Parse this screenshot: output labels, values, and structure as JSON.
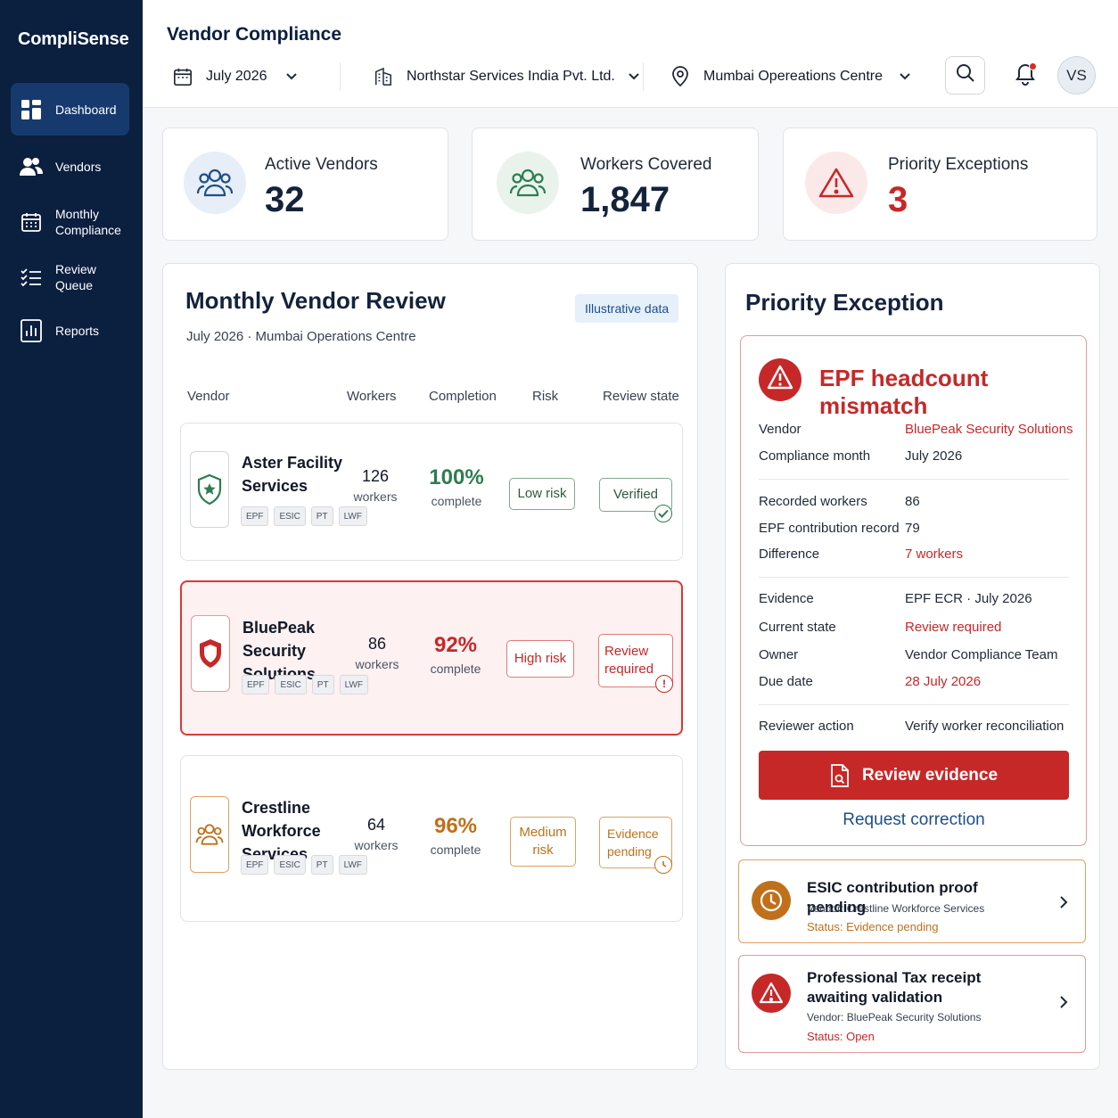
{
  "app": {
    "brand": "CompliSense"
  },
  "sidebar": {
    "items": [
      {
        "label": "Dashboard",
        "icon": "dashboard-icon",
        "active": true
      },
      {
        "label": "Vendors",
        "icon": "users-icon"
      },
      {
        "label": "Monthly Compliance",
        "icon": "calendar-icon"
      },
      {
        "label": "Review Queue",
        "icon": "checklist-icon"
      },
      {
        "label": "Reports",
        "icon": "bar-chart-icon"
      }
    ]
  },
  "header": {
    "title": "Vendor Compliance",
    "month": "July 2026",
    "company": "Northstar Services India Pvt. Ltd.",
    "location": "Mumbai Opereations Centre",
    "avatar_initials": "VS"
  },
  "kpis": [
    {
      "label": "Active Vendors",
      "value": "32",
      "icon": "users-icon"
    },
    {
      "label": "Workers Covered",
      "value": "1,847",
      "icon": "workers-icon"
    },
    {
      "label": "Priority Exceptions",
      "value": "3",
      "icon": "warning-icon"
    }
  ],
  "review": {
    "title": "Monthly Vendor Review",
    "tag": "Illustrative data",
    "subtitle": "July 2026 · Mumbai Operations Centre",
    "columns": [
      "Vendor",
      "Workers",
      "Completion",
      "Risk",
      "Review state"
    ],
    "rows": [
      {
        "name": "Aster Facility Services",
        "chips": [
          "EPF",
          "ESIC",
          "PT",
          "LWF"
        ],
        "workers": "126",
        "workers_label": "workers",
        "completion": "100%",
        "completion_label": "complete",
        "risk": "Low risk",
        "state": "Verified"
      },
      {
        "name": "BluePeak Security Solutions",
        "chips": [
          "EPF",
          "ESIC",
          "PT",
          "LWF"
        ],
        "workers": "86",
        "workers_label": "workers",
        "completion": "92%",
        "completion_label": "complete",
        "risk": "High risk",
        "state": "Review required"
      },
      {
        "name": "Crestline Workforce Services",
        "chips": [
          "EPF",
          "ESIC",
          "PT",
          "LWF"
        ],
        "workers": "64",
        "workers_label": "workers",
        "completion": "96%",
        "completion_label": "complete",
        "risk": "Medium risk",
        "state": "Evidence pending"
      }
    ]
  },
  "priority": {
    "title": "Priority Exception",
    "exception_title": "EPF headcount mismatch",
    "fields": {
      "vendor_label": "Vendor",
      "vendor": "BluePeak Security Solutions",
      "month_label": "Compliance month",
      "month": "July 2026",
      "recorded_label": "Recorded workers",
      "recorded": "86",
      "epf_label": "EPF contribution record",
      "epf": "79",
      "diff_label": "Difference",
      "diff": "7 workers",
      "evidence_label": "Evidence",
      "evidence": "EPF ECR · July 2026",
      "state_label": "Current state",
      "state": "Review required",
      "owner_label": "Owner",
      "owner": "Vendor Compliance Team",
      "due_label": "Due date",
      "due": "28 July 2026",
      "action_label": "Reviewer action",
      "action": "Verify worker reconciliation"
    },
    "primary_button": "Review evidence",
    "secondary_link": "Request correction",
    "others": [
      {
        "title": "ESIC contribution proof pending",
        "vendor": "Vendor: Crestline Workforce Services",
        "status": "Status: Evidence pending"
      },
      {
        "title": "Professional Tax receipt awaiting validation",
        "vendor": "Vendor: BluePeak Security Solutions",
        "status": "Status: Open"
      }
    ]
  },
  "colors": {
    "sidebar": "#0b1f3f",
    "danger": "#c62828",
    "success": "#2e7d4f",
    "warning": "#c0701a",
    "link": "#1d4e89"
  }
}
